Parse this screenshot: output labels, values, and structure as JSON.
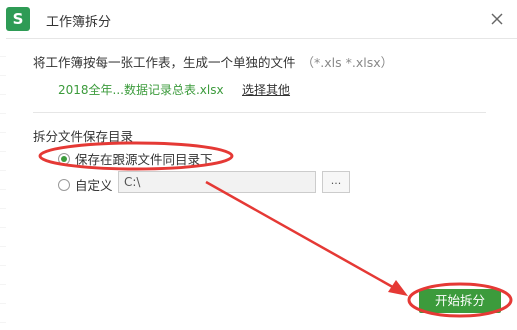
{
  "window": {
    "title": "工作簿拆分",
    "app_icon_letter": "S",
    "app_icon_color": "#2e9b55"
  },
  "description": {
    "text": "将工作簿按每一张工作表，生成一个单独的文件",
    "extensions": "（*.xls *.xlsx）"
  },
  "file": {
    "name": "2018全年...数据记录总表.xlsx",
    "choose_other_label": "选择其他"
  },
  "save_dir": {
    "section_label": "拆分文件保存目录",
    "option_same_label": "保存在跟源文件同目录下",
    "option_same_selected": true,
    "option_custom_label": "自定义",
    "option_custom_selected": false,
    "custom_path_value": "C:\\",
    "browse_label": "..."
  },
  "actions": {
    "start_label": "开始拆分"
  },
  "colors": {
    "accent": "#3c9b3c",
    "annotation": "#e53935"
  }
}
